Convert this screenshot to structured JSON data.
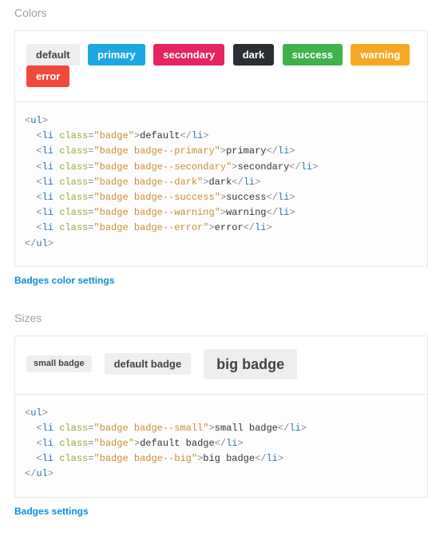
{
  "colors": {
    "title": "Colors",
    "items": [
      {
        "cls": "badge",
        "label": "default"
      },
      {
        "cls": "badge badge--primary",
        "label": "primary"
      },
      {
        "cls": "badge badge--secondary",
        "label": "secondary"
      },
      {
        "cls": "badge badge--dark",
        "label": "dark"
      },
      {
        "cls": "badge badge--success",
        "label": "success"
      },
      {
        "cls": "badge badge--warning",
        "label": "warning"
      },
      {
        "cls": "badge badge--error",
        "label": "error"
      }
    ],
    "link": "Badges color settings"
  },
  "sizes": {
    "title": "Sizes",
    "items": [
      {
        "cls": "badge badge--small",
        "label": "small badge"
      },
      {
        "cls": "badge",
        "label": "default badge"
      },
      {
        "cls": "badge badge--big",
        "label": "big badge"
      }
    ],
    "link": "Badges settings"
  }
}
